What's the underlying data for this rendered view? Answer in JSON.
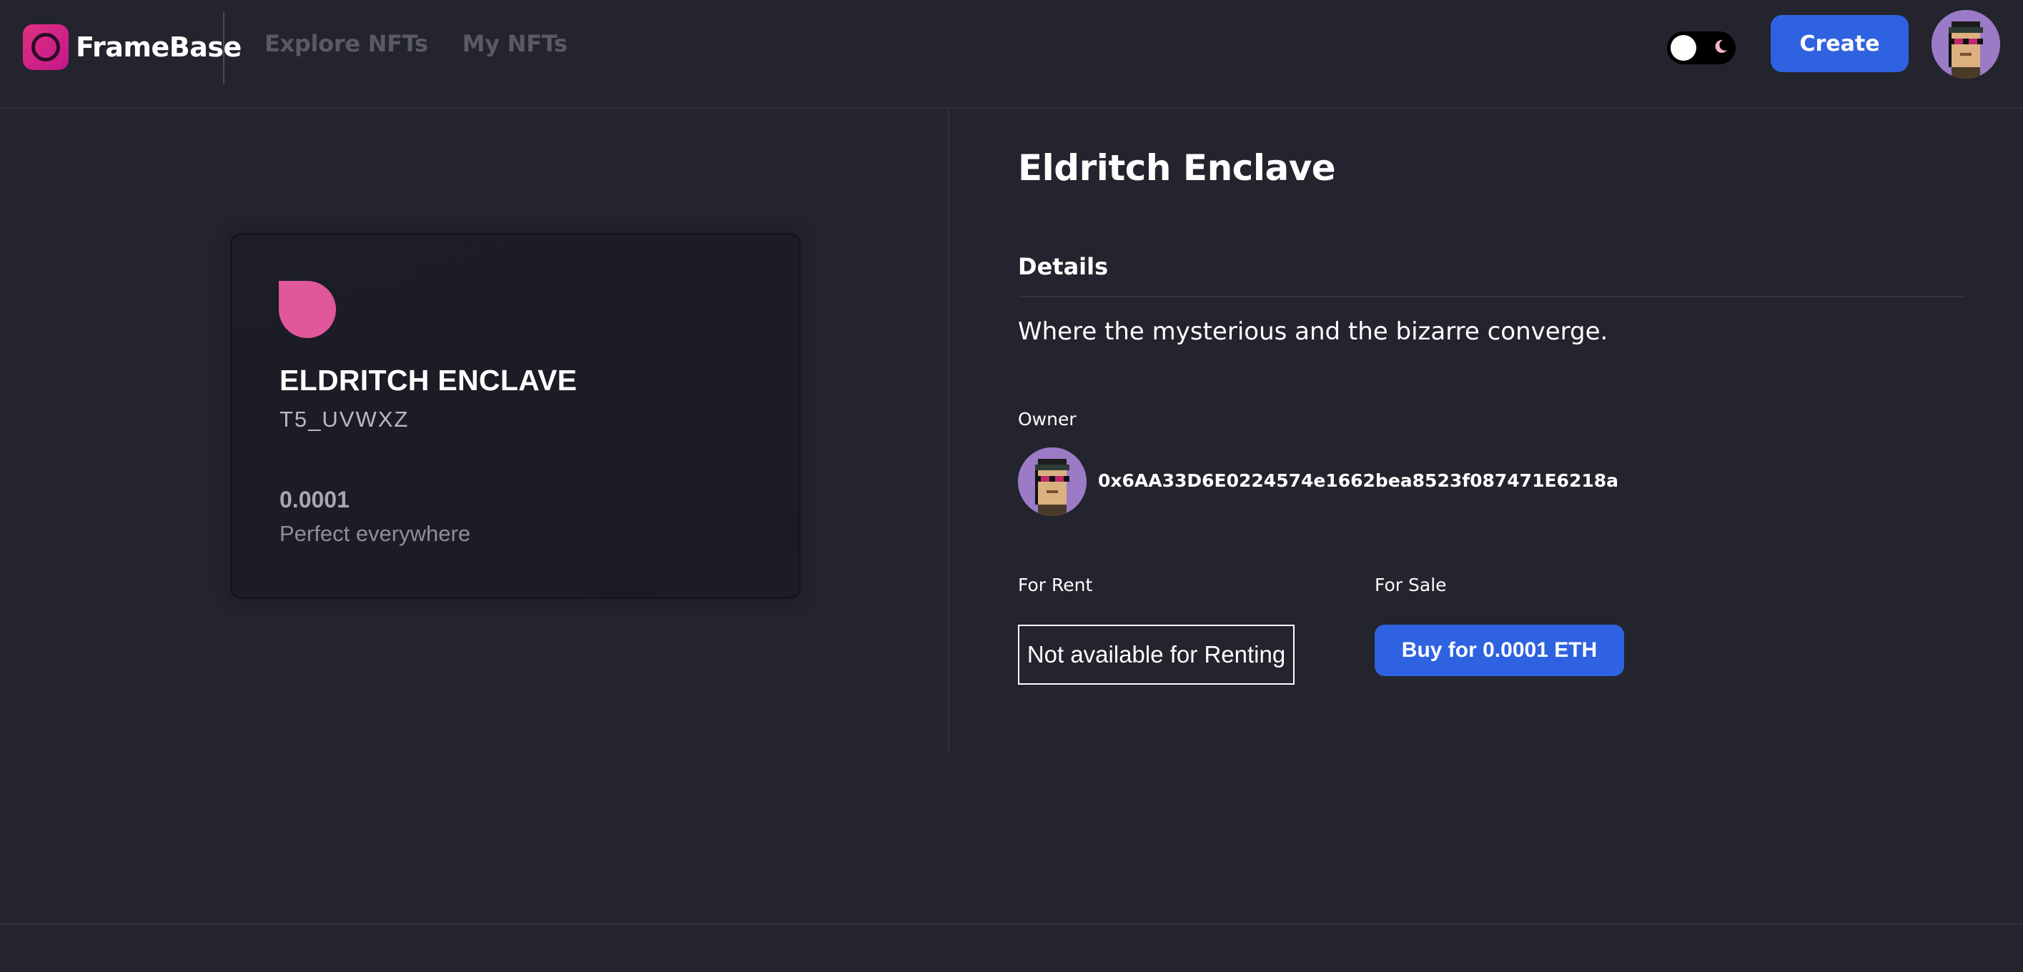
{
  "header": {
    "brand": "FrameBase",
    "nav": [
      {
        "label": "Explore NFTs"
      },
      {
        "label": "My NFTs"
      }
    ],
    "create_label": "Create",
    "theme": {
      "toggle_icon_left": "sun-circle",
      "toggle_icon_right": "moon-icon",
      "mode": "dark"
    },
    "avatar_icon": "pixel-punk-avatar"
  },
  "card": {
    "icon": "drop-icon",
    "name": "ELDRITCH ENCLAVE",
    "symbol": "T5_UVWXZ",
    "price": "0.0001",
    "description": "Perfect everywhere"
  },
  "detail": {
    "title": "Eldritch Enclave",
    "details_heading": "Details",
    "description": "Where the mysterious and the bizarre converge.",
    "owner_label": "Owner",
    "owner_address": "0x6AA33D6E0224574e1662bea8523f087471E6218a",
    "for_rent_label": "For Rent",
    "for_sale_label": "For Sale",
    "rent_status": "Not available for Renting",
    "buy_label": "Buy for 0.0001 ETH"
  },
  "colors": {
    "background": "#23242d",
    "accent_blue": "#2f62e0",
    "brand_pink": "#e0307f",
    "card_icon_pink": "#e0579a",
    "avatar_bg": "#9b7ac6"
  }
}
